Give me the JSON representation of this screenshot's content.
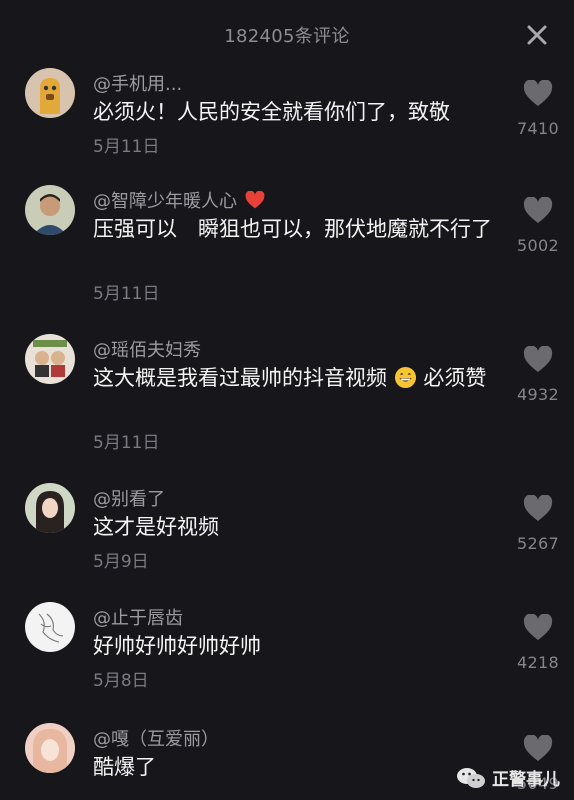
{
  "header": {
    "title": "182405条评论",
    "close_icon": "close-icon"
  },
  "comments": [
    {
      "username": "@手机用...",
      "text": "必须火！人民的安全就看你们了，致敬",
      "date": "5月11日",
      "likes": "7410",
      "avatar_color": "#d8c4ae"
    },
    {
      "username": "@智障少年暖人心",
      "text": "压强可以　瞬狙也可以，那伏地魔就不行了",
      "date": "5月11日",
      "likes": "5002",
      "avatar_color": "#c9cdb8",
      "badge_icon": "red-heart-icon"
    },
    {
      "username": "@瑶佰夫妇秀",
      "text_before": "这大概是我看过最帅的抖音视频",
      "text_after": "必须赞",
      "date": "5月11日",
      "likes": "4932",
      "avatar_color": "#e7e1d8",
      "inline_icon": "grinning-emoji-icon"
    },
    {
      "username": "@别看了",
      "text": "这才是好视频",
      "date": "5月9日",
      "likes": "5267",
      "avatar_color": "#cfd8c5"
    },
    {
      "username": "@止于唇齿",
      "text": "好帅好帅好帅好帅",
      "date": "5月8日",
      "likes": "4218",
      "avatar_color": "#f3f3f3"
    },
    {
      "username": "@嘎（互爱丽）",
      "text": "酷爆了",
      "likes": "5049",
      "avatar_color": "#f0d0c4"
    }
  ],
  "watermark": {
    "label": "正警事儿"
  },
  "colors": {
    "background": "#17161b",
    "text": "#f4f4f4",
    "muted": "#8d8c91",
    "heart": "#6b6a6f"
  }
}
